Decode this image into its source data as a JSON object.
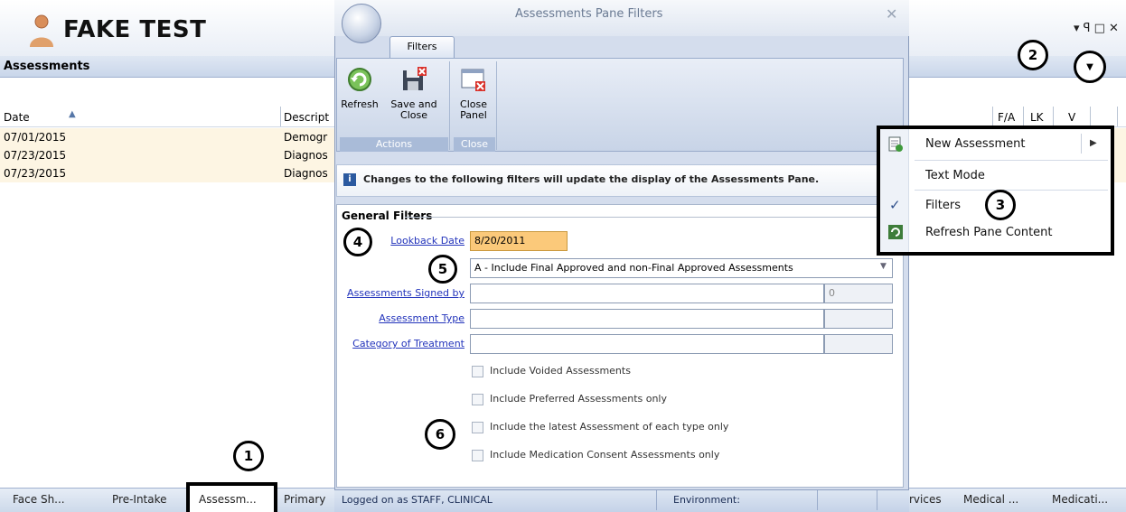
{
  "app": {
    "patient_name": "FAKE TEST",
    "window_controls": "▾ ꟼ □ ✕"
  },
  "assessments": {
    "title": "Assessments",
    "columns": {
      "date": "Date",
      "description": "Descript",
      "fa": "F/A",
      "lk": "LK",
      "v": "V"
    },
    "rows": [
      {
        "date": "07/01/2015",
        "description": "Demogr"
      },
      {
        "date": "07/23/2015",
        "description": "Diagnos"
      },
      {
        "date": "07/23/2015",
        "description": "Diagnos"
      }
    ]
  },
  "bottom_tabs": [
    "Face Sh...",
    "Pre-Intake",
    "Assessm...",
    "Primary",
    "rvices",
    "Medical ...",
    "Medicati..."
  ],
  "dialog": {
    "title": "Assessments Pane Filters",
    "close": "✕",
    "ribbon_tab": "Filters",
    "buttons": {
      "refresh": "Refresh",
      "save_close_1": "Save and",
      "save_close_2": "Close",
      "close_panel_1": "Close",
      "close_panel_2": "Panel"
    },
    "groups": {
      "actions": "Actions",
      "close": "Close"
    },
    "info_text": "Changes to the following filters will update the display of the Assessments Pane.",
    "general_filters": {
      "title": "General Filters",
      "lookback_label": "Lookback Date",
      "lookback_value": "8/20/2011",
      "approval_select": "A - Include Final Approved and non-Final Approved Assessments",
      "signed_by_label": "Assessments Signed by",
      "signed_by_count": "0",
      "type_label": "Assessment Type",
      "category_label": "Category of Treatment",
      "checkboxes": [
        "Include Voided Assessments",
        "Include Preferred Assessments only",
        "Include the latest Assessment of each type only",
        "Include Medication Consent Assessments only"
      ]
    },
    "status": {
      "logged_on": "Logged on as STAFF, CLINICAL",
      "environment": "Environment:"
    }
  },
  "context_menu": {
    "items": [
      "New Assessment",
      "Text Mode",
      "Filters",
      "Refresh Pane Content"
    ],
    "checked": "Filters"
  },
  "callouts": [
    "1",
    "2",
    "3",
    "4",
    "5",
    "6"
  ],
  "colors": {
    "highlight_input": "#fbc97a",
    "link": "#2233bb",
    "row_bg": "#fdf5e3"
  }
}
